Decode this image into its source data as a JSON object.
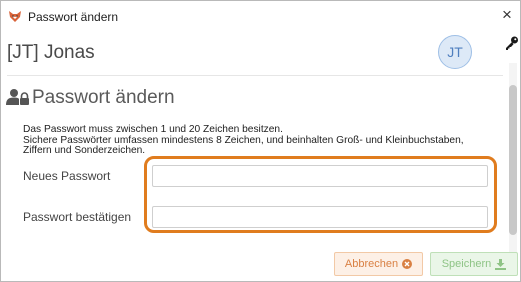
{
  "window": {
    "title": "Passwort ändern",
    "close_glyph": "×",
    "icon": "fox-app-icon"
  },
  "header": {
    "user_name": "[JT] Jonas",
    "avatar_initials": "JT",
    "key_icon": "key-icon"
  },
  "section": {
    "title": "Passwort ändern",
    "icon": "user-lock-icon"
  },
  "hint": {
    "line1": "Das Passwort muss zwischen 1 und 20 Zeichen besitzen.",
    "line2": "Sichere Passwörter umfassen mindestens 8 Zeichen, und beinhalten Groß- und Kleinbuchstaben,",
    "line3": "Ziffern und Sonderzeichen."
  },
  "form": {
    "new_password_label": "Neues Passwort",
    "new_password_value": "",
    "confirm_password_label": "Passwort bestätigen",
    "confirm_password_value": ""
  },
  "buttons": {
    "cancel_label": "Abbrechen",
    "cancel_icon": "close-circle-icon",
    "save_label": "Speichern",
    "save_icon": "download-icon"
  },
  "colors": {
    "highlight": "#e07c1e",
    "cancel_text": "#d98043",
    "save_text": "#8fc486",
    "avatar": "#4f7fbf"
  }
}
